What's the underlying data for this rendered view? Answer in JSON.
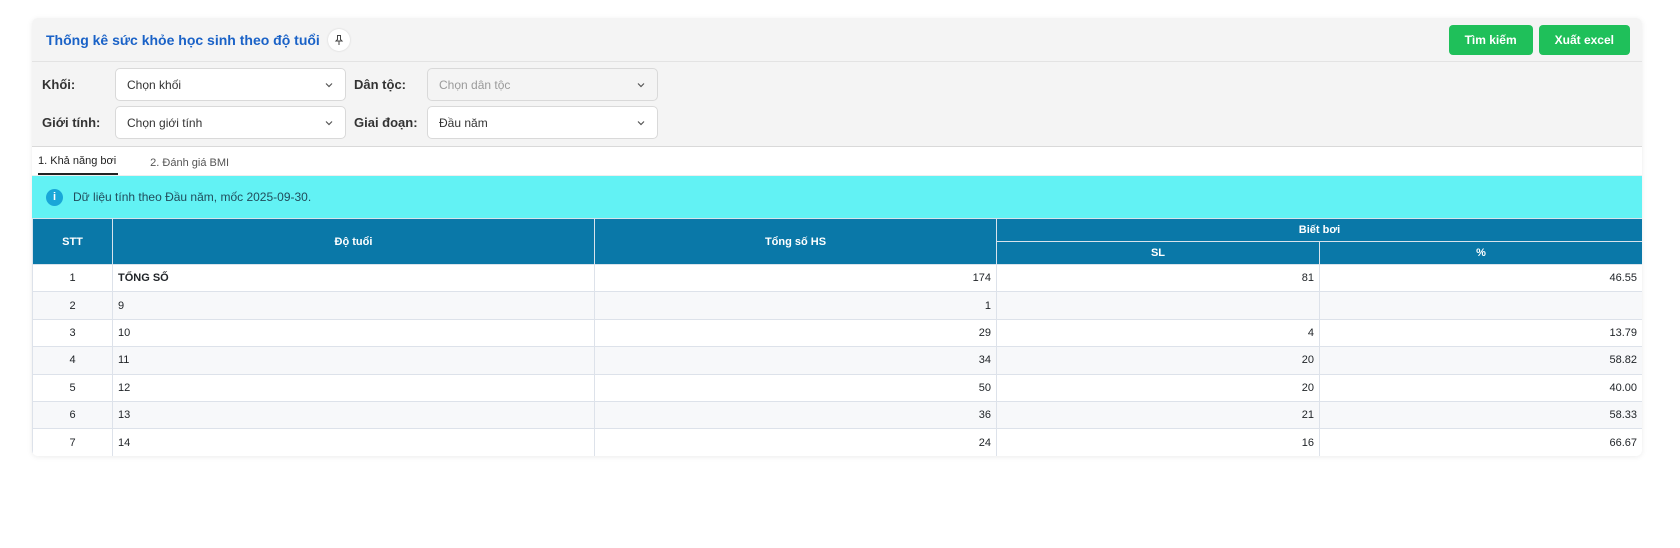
{
  "header": {
    "title": "Thống kê sức khỏe học sinh theo độ tuổi",
    "search_label": "Tìm kiếm",
    "export_label": "Xuất excel"
  },
  "filters": {
    "khoi_label": "Khối:",
    "khoi_value": "Chọn khối",
    "dantoc_label": "Dân tộc:",
    "dantoc_value": "Chọn dân tộc",
    "gioitinh_label": "Giới tính:",
    "gioitinh_value": "Chọn giới tính",
    "giaidoan_label": "Giai đoạn:",
    "giaidoan_value": "Đầu năm"
  },
  "tabs": [
    {
      "label": "1. Khả năng bơi"
    },
    {
      "label": "2. Đánh giá BMI"
    }
  ],
  "info": {
    "text": "Dữ liệu tính theo Đầu năm, mốc 2025-09-30."
  },
  "table": {
    "headers": {
      "stt": "STT",
      "do_tuoi": "Độ tuổi",
      "tong_so": "Tổng số HS",
      "biet_boi": "Biết bơi",
      "sl": "SL",
      "pct": "%"
    },
    "rows": [
      {
        "stt": "1",
        "age": "TỔNG SỐ",
        "total": "174",
        "sl": "81",
        "pct": "46.55"
      },
      {
        "stt": "2",
        "age": "9",
        "total": "1",
        "sl": "",
        "pct": ""
      },
      {
        "stt": "3",
        "age": "10",
        "total": "29",
        "sl": "4",
        "pct": "13.79"
      },
      {
        "stt": "4",
        "age": "11",
        "total": "34",
        "sl": "20",
        "pct": "58.82"
      },
      {
        "stt": "5",
        "age": "12",
        "total": "50",
        "sl": "20",
        "pct": "40.00"
      },
      {
        "stt": "6",
        "age": "13",
        "total": "36",
        "sl": "21",
        "pct": "58.33"
      },
      {
        "stt": "7",
        "age": "14",
        "total": "24",
        "sl": "16",
        "pct": "66.67"
      }
    ]
  },
  "colors": {
    "title": "#1a62c7",
    "button": "#1fc05a",
    "table_header": "#0a78a8",
    "info_bar": "#62f2f4"
  }
}
